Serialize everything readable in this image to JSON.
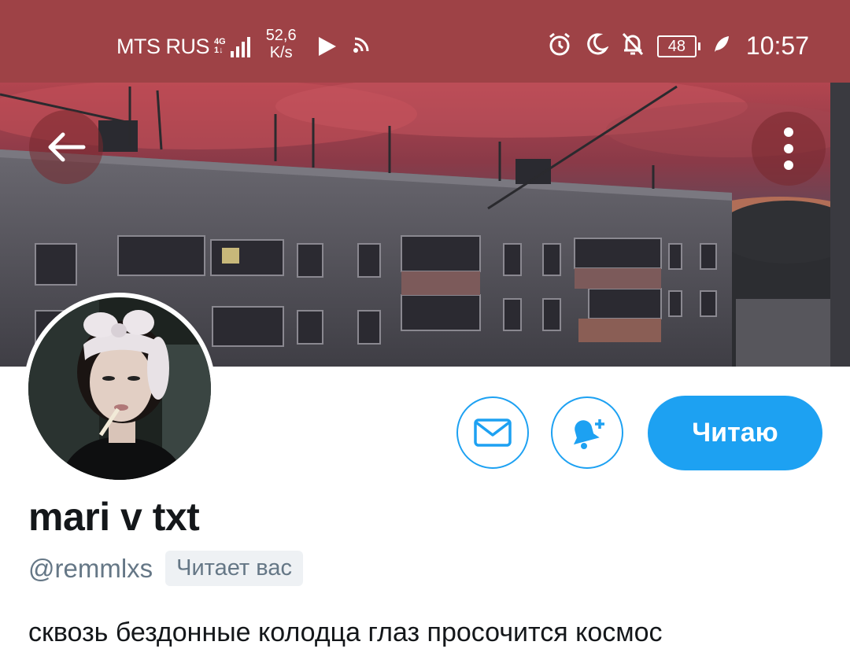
{
  "status_bar": {
    "carrier": "MTS RUS",
    "network_type_top": "4G",
    "network_type_bottom": "1↓",
    "speed_value": "52,6",
    "speed_unit": "K/s",
    "battery": "48",
    "time": "10:57",
    "icons": [
      "signal-icon",
      "play-icon",
      "cast-icon",
      "alarm-icon",
      "moon-icon",
      "bell-off-icon",
      "battery-icon",
      "leaf-icon"
    ]
  },
  "colors": {
    "status_bar_bg": "#9e4246",
    "accent": "#1da1f2",
    "secondary_text": "#657786",
    "primary_text": "#14171a"
  },
  "header": {
    "back_icon": "back-arrow-icon",
    "menu_icon": "more-vertical-icon"
  },
  "profile": {
    "display_name": "mari v txt",
    "handle": "@remmlxs",
    "follows_you_label": "Читает вас",
    "bio": "сквозь бездонные колодца глаз просочится космос"
  },
  "actions": {
    "message_icon": "envelope-icon",
    "notify_icon": "bell-plus-icon",
    "following_label": "Читаю"
  }
}
